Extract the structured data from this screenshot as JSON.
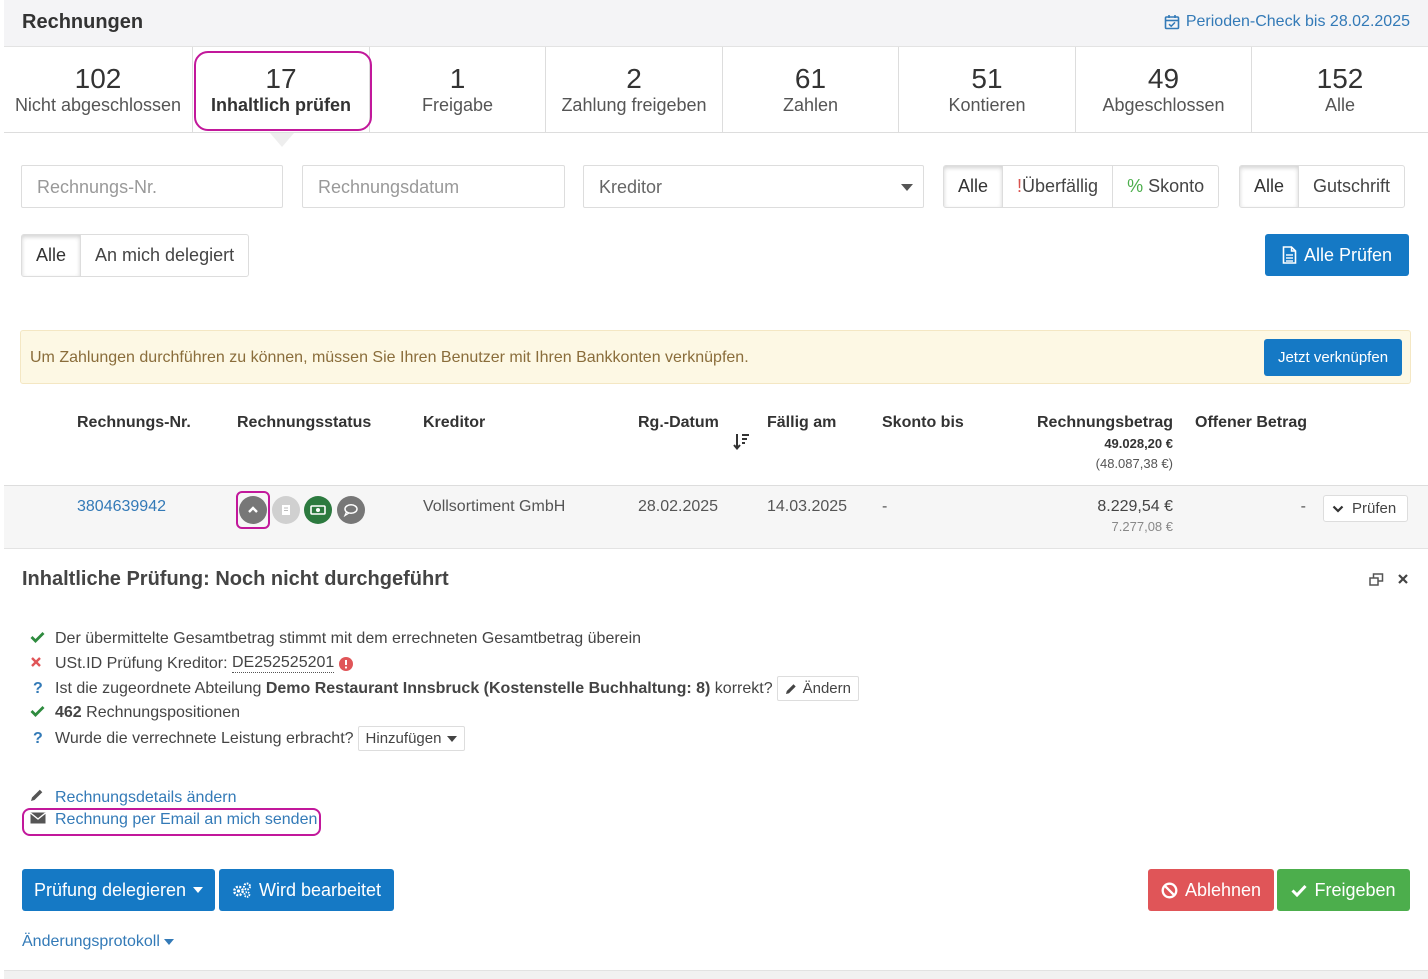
{
  "header": {
    "title": "Rechnungen",
    "period_check": "Perioden-Check bis 28.02.2025"
  },
  "tabs": [
    {
      "count": "102",
      "label": "Nicht abgeschlossen"
    },
    {
      "count": "17",
      "label": "Inhaltlich prüfen"
    },
    {
      "count": "1",
      "label": "Freigabe"
    },
    {
      "count": "2",
      "label": "Zahlung freigeben"
    },
    {
      "count": "61",
      "label": "Zahlen"
    },
    {
      "count": "51",
      "label": "Kontieren"
    },
    {
      "count": "49",
      "label": "Abgeschlossen"
    },
    {
      "count": "152",
      "label": "Alle"
    }
  ],
  "filters": {
    "invoice_no_placeholder": "Rechnungs-Nr.",
    "invoice_date_placeholder": "Rechnungsdatum",
    "creditor_select": "Kreditor",
    "status_group": {
      "all": "Alle",
      "overdue_mark": "!",
      "overdue": "Überfällig",
      "discount_mark": "%",
      "discount": "Skonto"
    },
    "type_group": {
      "all": "Alle",
      "credit": "Gutschrift"
    },
    "delegation_group": {
      "all": "Alle",
      "delegated": "An mich delegiert"
    },
    "check_all": "Alle Prüfen"
  },
  "alert": {
    "text": "Um Zahlungen durchführen zu können, müssen Sie Ihren Benutzer mit Ihren Bankkonten verknüpfen.",
    "button": "Jetzt verknüpfen"
  },
  "table": {
    "headers": {
      "invoice_no": "Rechnungs-Nr.",
      "status": "Rechnungsstatus",
      "creditor": "Kreditor",
      "date": "Rg.-Datum",
      "due": "Fällig am",
      "discount": "Skonto bis",
      "amount": "Rechnungsbetrag",
      "amount_total": "49.028,20 €",
      "amount_total_net": "(48.087,38 €)",
      "open": "Offener Betrag"
    },
    "row": {
      "invoice_no": "3804639942",
      "creditor": "Vollsortiment GmbH",
      "date": "28.02.2025",
      "due": "14.03.2025",
      "discount": "-",
      "amount": "8.229,54 €",
      "amount_net": "7.277,08 €",
      "open": "-",
      "action": "Prüfen"
    }
  },
  "panel": {
    "title": "Inhaltliche Prüfung: Noch nicht durchgeführt",
    "checks": {
      "total": "Der übermittelte Gesamtbetrag stimmt mit dem errechneten Gesamtbetrag überein",
      "vat_label": "USt.ID Prüfung Kreditor:",
      "vat_id": "DE252525201",
      "dept_pre": "Ist die zugeordnete Abteilung",
      "dept_name": "Demo Restaurant Innsbruck (Kostenstelle Buchhaltung: 8)",
      "dept_post": "korrekt?",
      "dept_btn": "Ändern",
      "positions_count": "462",
      "positions_label": "Rechnungspositionen",
      "service_q": "Wurde die verrechnete Leistung erbracht?",
      "service_btn": "Hinzufügen"
    },
    "links": {
      "edit": "Rechnungsdetails ändern",
      "email": "Rechnung per Email an mich senden"
    },
    "buttons": {
      "delegate": "Prüfung delegieren",
      "processing": "Wird bearbeitet",
      "reject": "Ablehnen",
      "approve": "Freigeben"
    },
    "changelog": "Änderungsprotokoll"
  },
  "colors": {
    "primary": "#1579c5",
    "danger": "#e05558",
    "success": "#4cae4c",
    "highlight": "#c2189b",
    "alert_bg": "#fdf8e4"
  }
}
